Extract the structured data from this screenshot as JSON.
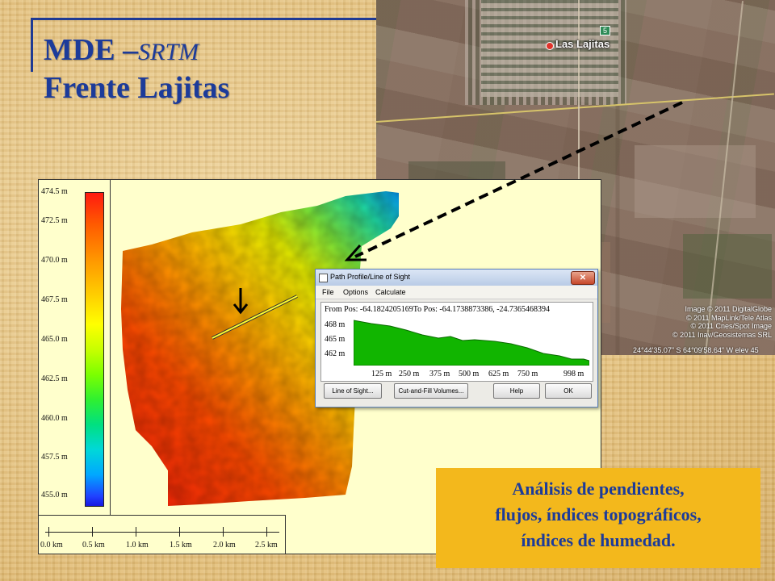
{
  "slide": {
    "title_main": "MDE –",
    "title_italic": "SRTM",
    "title_line2": "Frente Lajitas",
    "caption_lines": [
      "Análisis de pendientes,",
      "flujos,  índices topográficos,",
      "índices de humedad."
    ]
  },
  "satellite": {
    "place_label": "Las Lajitas",
    "route_label": "5",
    "credits": [
      "Image © 2011 DigitalGlobe",
      "© 2011 MapLink/Tele Atlas",
      "© 2011 Cnes/Spot Image",
      "© 2011 Inav/Geosistemas SRL"
    ],
    "coords": "24°44'35.07\" S  64°09'58.64\" W  elev  45"
  },
  "dem": {
    "elevation_ticks": [
      "474.5 m",
      "472.5 m",
      "470.0 m",
      "467.5 m",
      "465.0 m",
      "462.5 m",
      "460.0 m",
      "457.5 m",
      "455.0 m"
    ],
    "scale_labels": [
      "0.0 km",
      "0.5 km",
      "1.0 km",
      "1.5 km",
      "2.0 km",
      "2.5 km"
    ]
  },
  "dialog": {
    "title": "Path Profile/Line of Sight",
    "close_label": "✕",
    "menu": [
      "File",
      "Options",
      "Calculate"
    ],
    "position_text": "From Pos: -64.1824205169To Pos: -64.1738873386, -24.7365468394",
    "y_labels": [
      "468 m",
      "465 m",
      "462 m"
    ],
    "x_labels": [
      "125 m",
      "250 m",
      "375 m",
      "500 m",
      "625 m",
      "750 m",
      "998 m"
    ],
    "buttons": {
      "line_of_sight": "Line of Sight...",
      "cut_fill": "Cut-and-Fill Volumes...",
      "help": "Help",
      "ok": "OK"
    },
    "profile_color": "#11b500"
  }
}
